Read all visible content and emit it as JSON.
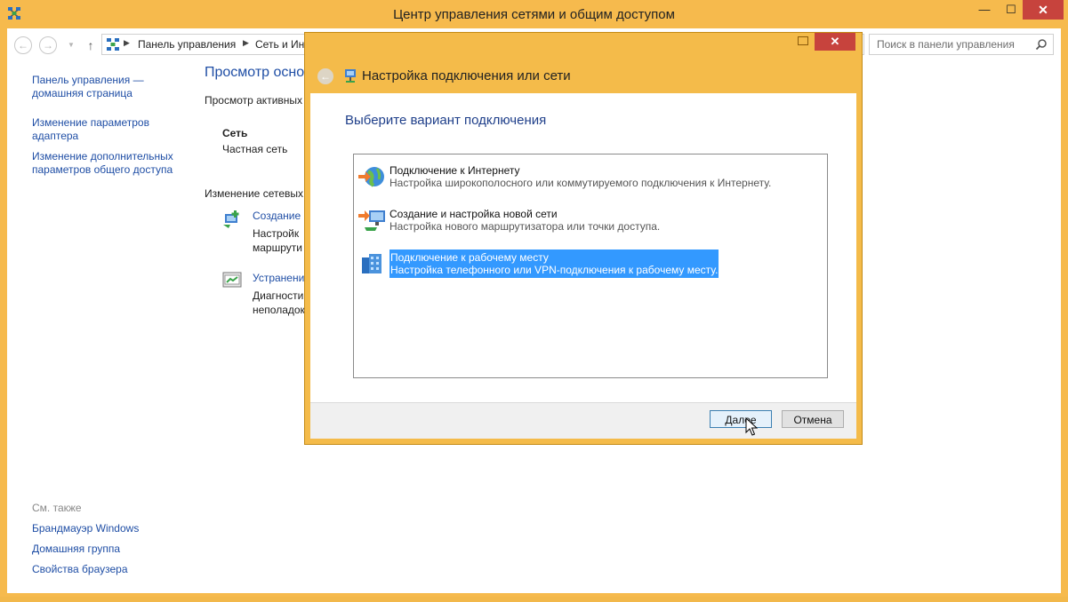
{
  "window": {
    "title": "Центр управления сетями и общим доступом",
    "min": "—",
    "max": "☐",
    "close": "✕"
  },
  "nav": {
    "back": "←",
    "forward": "→",
    "recent": "▼",
    "up": "↑",
    "breadcrumbs": [
      "Панель управления",
      "Сеть и Ин"
    ],
    "separator": "▶",
    "search_placeholder": "Поиск в панели управления"
  },
  "sidebar": {
    "items": [
      "Панель управления — домашняя страница",
      "Изменение параметров адаптера",
      "Изменение дополнительных параметров общего доступа"
    ],
    "see_also_label": "См. также",
    "see_also": [
      "Брандмауэр Windows",
      "Домашняя группа",
      "Свойства браузера"
    ]
  },
  "main": {
    "heading": "Просмотр основ",
    "active_label": "Просмотр активных",
    "network_name": "Сеть",
    "network_type": "Частная сеть",
    "change_label": "Изменение сетевых",
    "task1_link": "Создание и",
    "task1_desc1": "Настройк",
    "task1_desc2": "маршрути",
    "task2_link": "Устранени",
    "task2_desc1": "Диагности",
    "task2_desc2": "неполадок"
  },
  "dialog": {
    "back": "←",
    "min": "—",
    "close": "✕",
    "title": "Настройка подключения или сети",
    "heading": "Выберите вариант подключения",
    "options": [
      {
        "title": "Подключение к Интернету",
        "desc": "Настройка широкополосного или коммутируемого подключения к Интернету.",
        "icon": "globe-arrow-icon"
      },
      {
        "title": "Создание и настройка новой сети",
        "desc": "Настройка нового маршрутизатора или точки доступа.",
        "icon": "router-arrow-icon"
      },
      {
        "title": "Подключение к рабочему месту",
        "desc": "Настройка телефонного или VPN-подключения к рабочему месту.",
        "icon": "workplace-icon",
        "selected": true
      }
    ],
    "next": "Далее",
    "cancel": "Отмена"
  },
  "colors": {
    "accent": "#f6ba4d",
    "link": "#1f4ea5",
    "selection": "#3399ff",
    "close": "#c7433d"
  }
}
